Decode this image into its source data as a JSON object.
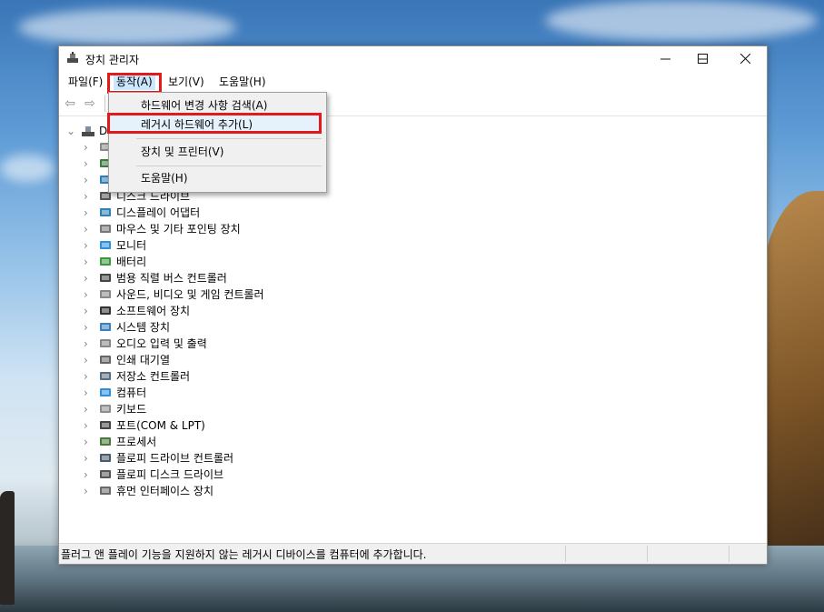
{
  "window": {
    "title": "장치 관리자",
    "controls": {
      "minimize": "—",
      "maximize": "☐",
      "close": "✕"
    }
  },
  "menubar": {
    "items": [
      {
        "label": "파일(F)",
        "active": false
      },
      {
        "label": "동작(A)",
        "active": true
      },
      {
        "label": "보기(V)",
        "active": false
      },
      {
        "label": "도움말(H)",
        "active": false
      }
    ]
  },
  "toolbar": {
    "back_icon": "⇦",
    "forward_icon": "⇨"
  },
  "context_menu": {
    "items": [
      {
        "label": "하드웨어 변경 사항 검색(A)",
        "highlighted": false
      },
      {
        "label": "레거시 하드웨어 추가(L)",
        "highlighted": true
      },
      {
        "label": "장치 및 프린터(V)",
        "highlighted": false
      },
      {
        "label": "도움말(H)",
        "highlighted": false
      }
    ]
  },
  "tree": {
    "root_label": "D",
    "items": [
      {
        "label": "",
        "icon": "ide-icon"
      },
      {
        "label": "",
        "icon": "network-icon"
      },
      {
        "label": "",
        "icon": "display-adapter-icon"
      },
      {
        "label": "디스크 드라이브",
        "icon": "disk-drive-icon"
      },
      {
        "label": "디스플레이 어댑터",
        "icon": "display-adapter-icon"
      },
      {
        "label": "마우스 및 기타 포인팅 장치",
        "icon": "mouse-icon"
      },
      {
        "label": "모니터",
        "icon": "monitor-icon"
      },
      {
        "label": "배터리",
        "icon": "battery-icon"
      },
      {
        "label": "범용 직렬 버스 컨트롤러",
        "icon": "usb-icon"
      },
      {
        "label": "사운드, 비디오 및 게임 컨트롤러",
        "icon": "speaker-icon"
      },
      {
        "label": "소프트웨어 장치",
        "icon": "software-device-icon"
      },
      {
        "label": "시스템 장치",
        "icon": "system-folder-icon"
      },
      {
        "label": "오디오 입력 및 출력",
        "icon": "speaker-icon"
      },
      {
        "label": "인쇄 대기열",
        "icon": "printer-icon"
      },
      {
        "label": "저장소 컨트롤러",
        "icon": "storage-controller-icon"
      },
      {
        "label": "컴퓨터",
        "icon": "computer-icon"
      },
      {
        "label": "키보드",
        "icon": "keyboard-icon"
      },
      {
        "label": "포트(COM & LPT)",
        "icon": "port-icon"
      },
      {
        "label": "프로세서",
        "icon": "processor-icon"
      },
      {
        "label": "플로피 드라이브 컨트롤러",
        "icon": "floppy-controller-icon"
      },
      {
        "label": "플로피 디스크 드라이브",
        "icon": "floppy-drive-icon"
      },
      {
        "label": "휴먼 인터페이스 장치",
        "icon": "hid-icon"
      }
    ]
  },
  "statusbar": {
    "text": "플러그 앤 플레이 기능을 지원하지 않는 레거시 디바이스를 컴퓨터에 추가합니다."
  },
  "colors": {
    "highlight_box": "#e21a1a",
    "menu_active": "#cce8ff",
    "menu_bg": "#f0f0f0"
  }
}
